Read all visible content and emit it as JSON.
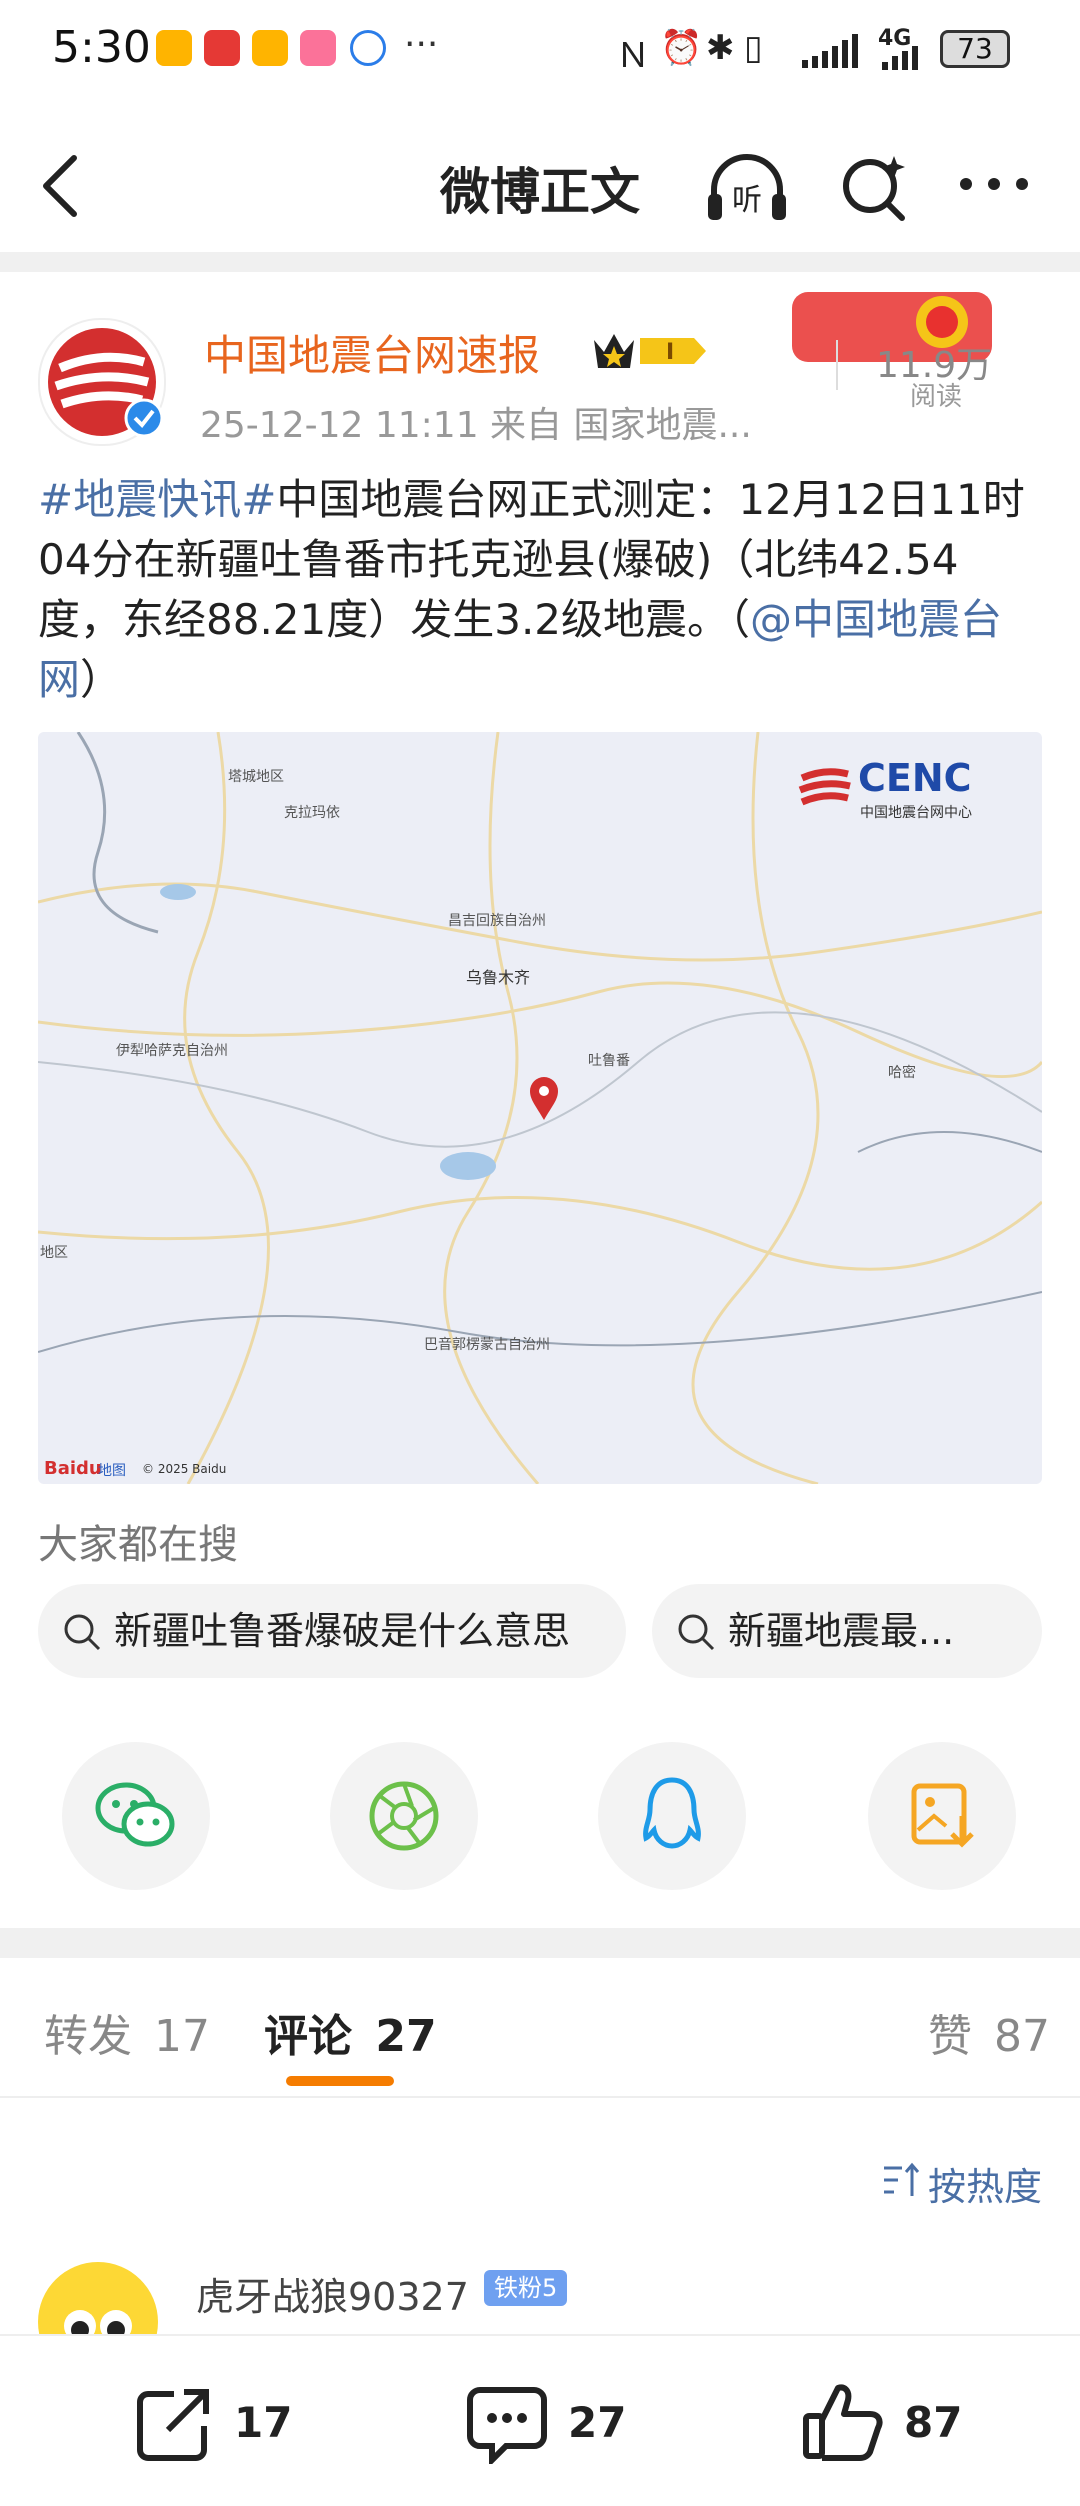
{
  "status_bar": {
    "time": "5:30",
    "more": "···",
    "network": "4G",
    "battery": "73"
  },
  "nav": {
    "title": "微博正文",
    "listen_label": "听"
  },
  "post": {
    "author": "中国地震台网速报",
    "meta": "25-12-12 11:11  来自 国家地震...",
    "reads": "11.9万",
    "reads_label": "阅读",
    "hashtag": "#地震快讯#",
    "text": "中国地震台网正式测定：12月12日11时04分在新疆吐鲁番市托克逊县(爆破)（北纬42.54度，东经88.21度）发生3.2级地震。（",
    "mention": "@中国地震台网",
    "text_end": "）"
  },
  "map": {
    "labels": {
      "tacheng": "塔城地区",
      "kelamayi": "克拉玛依",
      "changji": "昌吉回族自治州",
      "urumqi": "乌鲁木齐",
      "yili": "伊犁哈萨克自治州",
      "turpan": "吐鲁番",
      "hami": "哈密",
      "aksu_partial": "地区",
      "bayingol": "巴音郭楞蒙古自治州"
    },
    "cenc_logo": "CENC",
    "cenc_sub": "中国地震台网中心",
    "baidu": "Baidu",
    "baidu_map": "地图",
    "copyright": "© 2025 Baidu"
  },
  "hot_search": {
    "title": "大家都在搜",
    "items": [
      "新疆吐鲁番爆破是什么意思",
      "新疆地震最..."
    ]
  },
  "share_icons": [
    "wechat-icon",
    "moments-icon",
    "qq-icon",
    "save-image-icon"
  ],
  "tabs": {
    "repost_label": "转发",
    "repost_count": "17",
    "comment_label": "评论",
    "comment_count": "27",
    "like_label": "赞",
    "like_count": "87"
  },
  "sort_label": "按热度",
  "comment": {
    "user": "虎牙战狼90327",
    "badge": "铁粉5"
  },
  "bottom_bar": {
    "repost": "17",
    "comment": "27",
    "like": "87"
  },
  "colors": {
    "accent": "#f57c00",
    "author": "#e8651e",
    "link": "#4a6fa5"
  }
}
